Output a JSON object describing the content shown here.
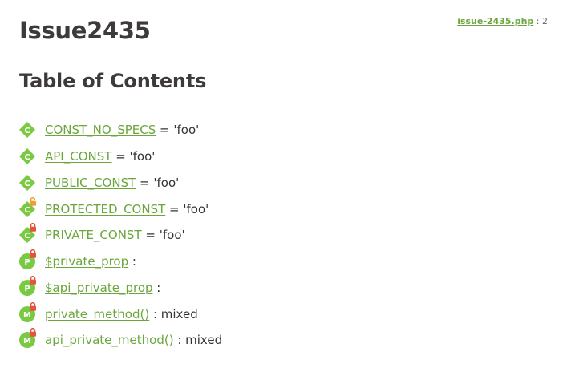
{
  "title": "Issue2435",
  "source": {
    "file": "issue-2435.php",
    "separator": " : ",
    "line": "2"
  },
  "toc_heading": "Table of Contents",
  "items": [
    {
      "type": "constant",
      "badge_letter": "C",
      "visibility": "public",
      "name": "CONST_NO_SPECS",
      "sep": " = ",
      "detail": "'foo'"
    },
    {
      "type": "constant",
      "badge_letter": "C",
      "visibility": "public",
      "name": "API_CONST",
      "sep": " = ",
      "detail": "'foo'"
    },
    {
      "type": "constant",
      "badge_letter": "C",
      "visibility": "public",
      "name": "PUBLIC_CONST",
      "sep": " = ",
      "detail": "'foo'"
    },
    {
      "type": "constant",
      "badge_letter": "C",
      "visibility": "protected",
      "name": "PROTECTED_CONST",
      "sep": " = ",
      "detail": "'foo'"
    },
    {
      "type": "constant",
      "badge_letter": "C",
      "visibility": "private",
      "name": "PRIVATE_CONST",
      "sep": " = ",
      "detail": "'foo'"
    },
    {
      "type": "property",
      "badge_letter": "P",
      "visibility": "private",
      "name": "$private_prop",
      "sep": " : ",
      "detail": ""
    },
    {
      "type": "property",
      "badge_letter": "P",
      "visibility": "private",
      "name": "$api_private_prop",
      "sep": " : ",
      "detail": ""
    },
    {
      "type": "method",
      "badge_letter": "M",
      "visibility": "private",
      "name": "private_method()",
      "sep": " : ",
      "detail": "mixed"
    },
    {
      "type": "method",
      "badge_letter": "M",
      "visibility": "private",
      "name": "api_private_method()",
      "sep": " : ",
      "detail": "mixed"
    }
  ],
  "colors": {
    "accent_green": "#6aa63b",
    "badge_green": "#7ac943",
    "lock_private": "#e5533c",
    "lock_protected": "#f0a030",
    "heading": "#3f3a3a",
    "text": "#333333"
  }
}
